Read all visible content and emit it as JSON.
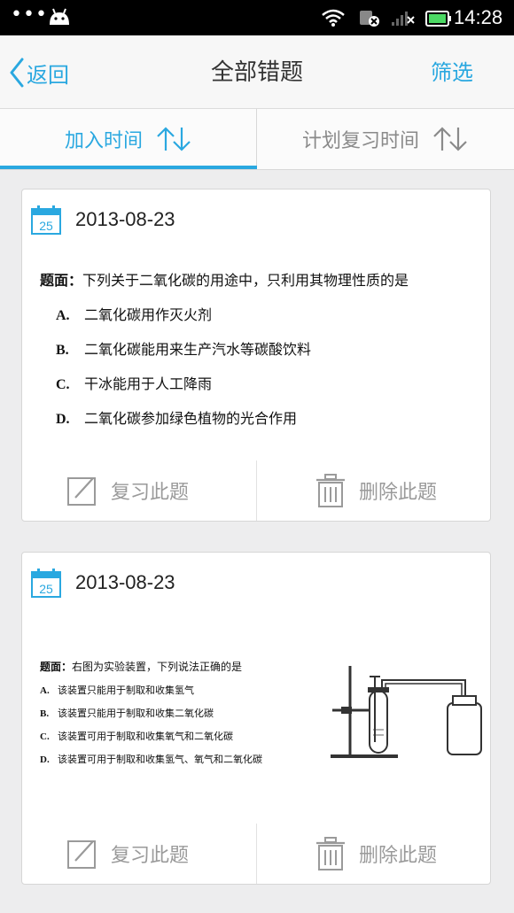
{
  "status_bar": {
    "time": "14:28"
  },
  "nav": {
    "back_label": "返回",
    "title": "全部错题",
    "filter_label": "筛选"
  },
  "tabs": [
    {
      "label": "加入时间",
      "active": true
    },
    {
      "label": "计划复习时间",
      "active": false
    }
  ],
  "cards": [
    {
      "calendar_day": "25",
      "date": "2013-08-23",
      "question": {
        "stem_prefix": "题面：",
        "stem": "下列关于二氧化碳的用途中，只利用其物理性质的是",
        "options": [
          {
            "letter": "A.",
            "text": "二氧化碳用作灭火剂"
          },
          {
            "letter": "B.",
            "text": "二氧化碳能用来生产汽水等碳酸饮料"
          },
          {
            "letter": "C.",
            "text": "干冰能用于人工降雨"
          },
          {
            "letter": "D.",
            "text": "二氧化碳参加绿色植物的光合作用"
          }
        ]
      },
      "review_label": "复习此题",
      "delete_label": "删除此题"
    },
    {
      "calendar_day": "25",
      "date": "2013-08-23",
      "question": {
        "stem_prefix": "题面：",
        "stem": "右图为实验装置，下列说法正确的是",
        "options": [
          {
            "letter": "A.",
            "text": "该装置只能用于制取和收集氢气"
          },
          {
            "letter": "B.",
            "text": "该装置只能用于制取和收集二氧化碳"
          },
          {
            "letter": "C.",
            "text": "该装置可用于制取和收集氧气和二氧化碳"
          },
          {
            "letter": "D.",
            "text": "该装置可用于制取和收集氢气、氧气和二氧化碳"
          }
        ]
      },
      "review_label": "复习此题",
      "delete_label": "删除此题"
    }
  ],
  "colors": {
    "accent": "#2aa8e0",
    "inactive": "#8a8a8a",
    "background": "#ededee"
  }
}
